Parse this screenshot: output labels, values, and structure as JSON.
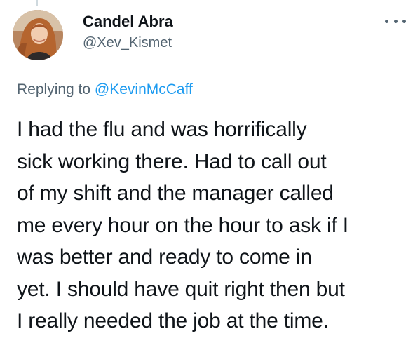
{
  "user": {
    "display_name": "Candel Abra",
    "handle": "@Xev_Kismet",
    "avatar_icon": "profile-photo"
  },
  "more_icon": "more-horizontal-icon",
  "reply": {
    "prefix": "Replying to ",
    "mention": "@KevinMcCaff"
  },
  "tweet_text": "I had the flu and was horrifically\nsick working there. Had to call out\nof my shift and the manager called\nme every hour on the hour to ask if I\nwas better and ready to come in\nyet. I should have quit right then but\nI really needed the job at the time.",
  "colors": {
    "link": "#1d9bf0",
    "secondary_text": "#536471",
    "primary_text": "#0f1419"
  }
}
